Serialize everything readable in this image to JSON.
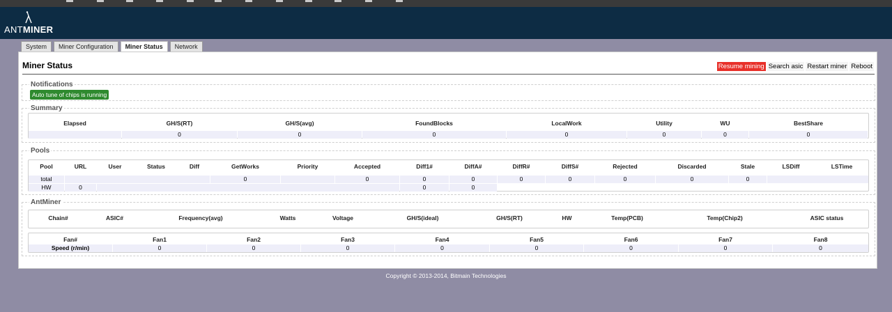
{
  "brand": {
    "prefix": "ANT",
    "suffix": "MINER"
  },
  "tabs": [
    "System",
    "Miner Configuration",
    "Miner Status",
    "Network"
  ],
  "page_title": "Miner Status",
  "actions": {
    "resume": "Resume mining",
    "search": "Search asic",
    "restart": "Restart miner",
    "reboot": "Reboot"
  },
  "notifications": {
    "legend": "Notifications",
    "message": "Auto tune of chips is running"
  },
  "summary": {
    "legend": "Summary",
    "headers": [
      "Elapsed",
      "GH/S(RT)",
      "GH/S(avg)",
      "FoundBlocks",
      "LocalWork",
      "Utility",
      "WU",
      "BestShare"
    ],
    "values": [
      "",
      "0",
      "0",
      "0",
      "0",
      "0",
      "0",
      "0"
    ]
  },
  "pools": {
    "legend": "Pools",
    "headers": [
      "Pool",
      "URL",
      "User",
      "Status",
      "Diff",
      "GetWorks",
      "Priority",
      "Accepted",
      "Diff1#",
      "DiffA#",
      "DiffR#",
      "DiffS#",
      "Rejected",
      "Discarded",
      "Stale",
      "LSDiff",
      "LSTime"
    ],
    "total_label": "total",
    "total_values": [
      "0",
      "0",
      "0",
      "0",
      "0",
      "0",
      "0",
      "0",
      "0"
    ],
    "hw_label": "HW",
    "hw_values": [
      "0",
      "0",
      "0"
    ]
  },
  "antminer": {
    "legend": "AntMiner",
    "headers": [
      "Chain#",
      "ASIC#",
      "Frequency(avg)",
      "Watts",
      "Voltage",
      "GH/S(ideal)",
      "GH/S(RT)",
      "HW",
      "Temp(PCB)",
      "Temp(Chip2)",
      "ASIC status"
    ],
    "fan_headers": [
      "Fan#",
      "Fan1",
      "Fan2",
      "Fan3",
      "Fan4",
      "Fan5",
      "Fan6",
      "Fan7",
      "Fan8"
    ],
    "speed_label": "Speed (r/min)",
    "fan_values": [
      "0",
      "0",
      "0",
      "0",
      "0",
      "0",
      "0",
      "0"
    ]
  },
  "footer": "Copyright © 2013-2014, Bitmain Technologies",
  "colors": {
    "header_bg": "#0d2c44",
    "page_bg": "#8f8ca4",
    "notif_green": "#2f8a2f",
    "resume_red": "#e8302a"
  }
}
